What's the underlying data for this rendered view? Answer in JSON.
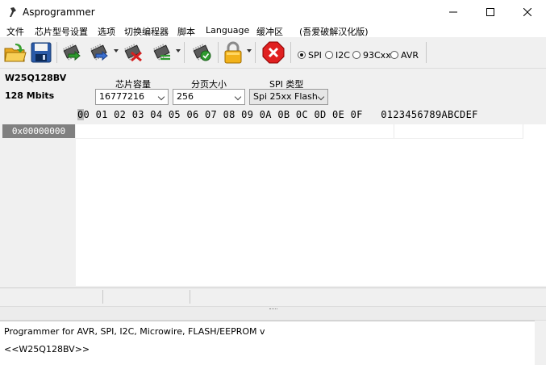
{
  "window": {
    "title": "Asprogrammer"
  },
  "menu": [
    "文件",
    "芯片型号设置",
    "选项",
    "切换编程器",
    "脚本",
    "Language",
    "缓冲区",
    "(吾爱破解汉化版)"
  ],
  "toolbar": {
    "buttons": [
      "open-icon",
      "save-icon",
      "read-chip-icon",
      "write-chip-icon",
      "erase-chip-icon",
      "verify-chip-icon",
      "check-blank-icon",
      "lock-icon",
      "stop-icon"
    ],
    "interfaces": [
      {
        "label": "SPI",
        "selected": true
      },
      {
        "label": "I2C",
        "selected": false
      },
      {
        "label": "93Cxx",
        "selected": false
      },
      {
        "label": "AVR",
        "selected": false
      }
    ]
  },
  "chip": {
    "name": "W25Q128BV",
    "size": "128 Mbits"
  },
  "fields": {
    "capacity_label": "芯片容量",
    "capacity_value": "16777216",
    "page_label": "分页大小",
    "page_value": "256",
    "spi_label": "SPI 类型",
    "spi_value": "Spi 25xx Flash"
  },
  "hex": {
    "header_cursor": "0",
    "header": "0 01 02 03 04 05 06 07 08 09 0A 0B 0C 0D 0E 0F   0123456789ABCDEF",
    "address": "0x00000000"
  },
  "log": {
    "lines": [
      "Programmer for AVR, SPI, I2C, Microwire, FLASH/EEPROM v",
      "<<W25Q128BV>>"
    ]
  }
}
